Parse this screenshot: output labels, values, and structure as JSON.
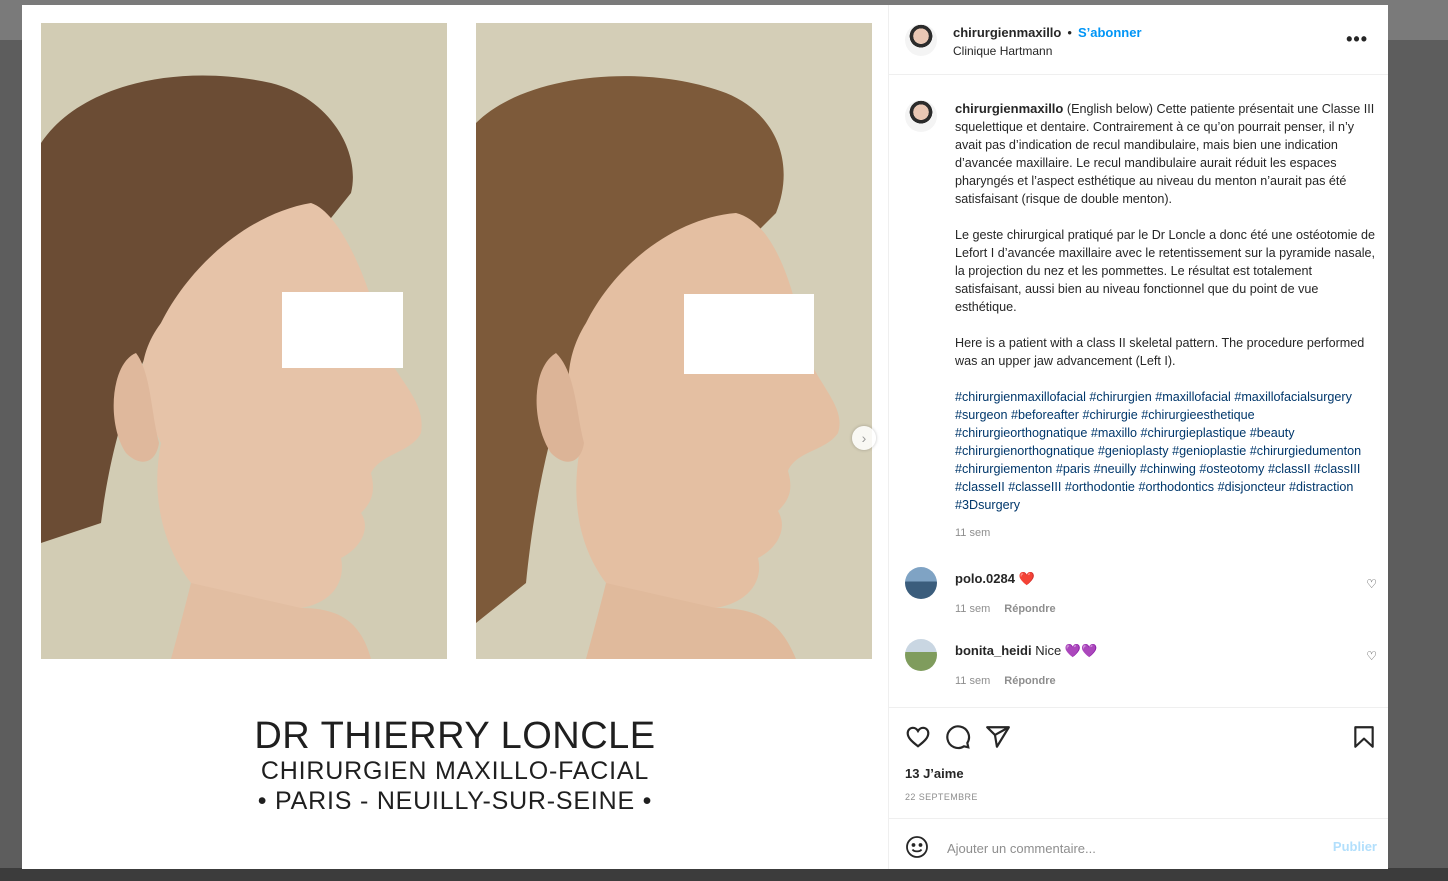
{
  "post": {
    "username": "chirurgienmaxillo",
    "separator": "•",
    "follow_label": "S’abonner",
    "location": "Clinique Hartmann",
    "more_glyph": "•••"
  },
  "media": {
    "brand_name": "DR THIERRY LONCLE",
    "brand_title": "CHIRURGIEN MAXILLO-FACIAL",
    "brand_place": "• PARIS - NEUILLY-SUR-SEINE •",
    "next_glyph": "›"
  },
  "caption": {
    "username": "chirurgienmaxillo",
    "paragraph1": "(English below) Cette patiente présentait une Classe III squelettique et dentaire. Contrairement à ce qu’on pourrait penser, il n’y avait pas d’indication de recul mandibulaire, mais bien une indication d’avancée maxillaire. Le recul mandibulaire aurait réduit les espaces pharyngés et l’aspect esthétique au niveau du menton n’aurait pas été satisfaisant (risque de double menton).",
    "paragraph2": "Le geste chirurgical pratiqué par le Dr Loncle a donc été une ostéotomie de Lefort I d’avancée maxillaire avec le retentissement sur la pyramide nasale, la projection du nez et les pommettes. Le résultat est totalement satisfaisant, aussi bien au niveau fonctionnel que du point de vue esthétique.",
    "paragraph3": "Here is a patient with a class II skeletal pattern. The procedure performed was an upper jaw advancement (Left I).",
    "hashtags": [
      "#chirurgienmaxillofacial",
      "#chirurgien",
      "#maxillofacial",
      "#maxillofacialsurgery",
      "#surgeon",
      "#beforeafter",
      "#chirurgie",
      "#chirurgieesthetique",
      "#chirurgieorthognatique",
      "#maxillo",
      "#chirurgieplastique",
      "#beauty",
      "#chirurgienorthognatique",
      "#genioplasty",
      "#genioplastie",
      "#chirurgiedumenton",
      "#chirurgiementon",
      "#paris",
      "#neuilly",
      "#chinwing",
      "#osteotomy",
      "#classII",
      "#classIII",
      "#classeII",
      "#classeIII",
      "#orthodontie",
      "#orthodontics",
      "#disjoncteur",
      "#distraction",
      "#3Dsurgery"
    ],
    "time": "11 sem"
  },
  "comments": [
    {
      "username": "polo.0284",
      "text": "❤️",
      "time": "11 sem",
      "reply_label": "Répondre"
    },
    {
      "username": "bonita_heidi",
      "text": "Nice 💜💜",
      "time": "11 sem",
      "reply_label": "Répondre"
    }
  ],
  "footer": {
    "likes": "13 J’aime",
    "date": "22 SEPTEMBRE",
    "comment_placeholder": "Ajouter un commentaire...",
    "publish_label": "Publier"
  },
  "colors": {
    "accent": "#0095f6",
    "hashtag": "#00376b",
    "muted": "#8e8e8e",
    "publish_disabled": "#b2dffc"
  }
}
